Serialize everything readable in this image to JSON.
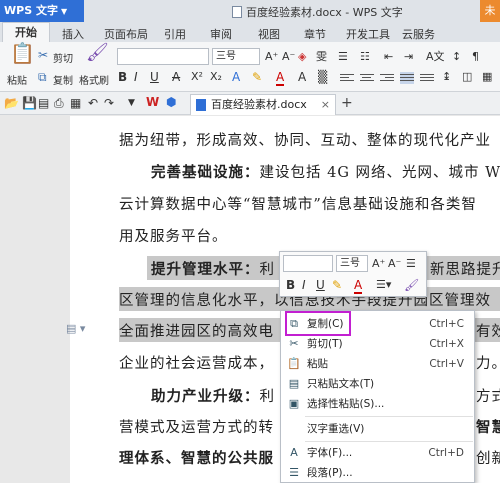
{
  "titlebar": {
    "app": "WPS 文字",
    "doc_title": "百度经验素材.docx - WPS 文字",
    "corner": "未"
  },
  "tabs": [
    "开始",
    "插入",
    "页面布局",
    "引用",
    "审阅",
    "视图",
    "章节",
    "开发工具",
    "云服务"
  ],
  "ribbon": {
    "paste": "粘贴",
    "cut": "剪切",
    "copy": "复制",
    "format_painter": "格式刷",
    "font_size": "三号",
    "font_name": ""
  },
  "doc_tab": {
    "name": "百度经验素材.docx"
  },
  "document": {
    "lines": [
      {
        "text": "据为纽带，形成高效、协同、互动、整体的现代化产业"
      },
      {
        "bold": "完善基础设施：",
        "text": "建设包括 4G 网络、光网、城市 W"
      },
      {
        "text": "云计算数据中心等“智慧城市”信息基础设施和各类智"
      },
      {
        "text": "用及服务平台。"
      },
      {
        "bold": "提升管理水平：",
        "text": "利",
        "tail": "新思路提升"
      },
      {
        "text": "区管理的信息化水平，以信息技术手段提升园区管理效"
      },
      {
        "text": "全面推进园区的高效电",
        "tail": "有效"
      },
      {
        "text": "企业的社会运营成本，",
        "tail": "力。"
      },
      {
        "bold": "助力产业升级：",
        "text": "利",
        "tail": "方式"
      },
      {
        "text": "营模式及运营方式的转",
        "tail": "智慧"
      },
      {
        "bold": "理体系、智慧的公共服",
        "tail": "创新"
      }
    ]
  },
  "mini_toolbar": {
    "font_size": "三号"
  },
  "context_menu": {
    "items": [
      {
        "label": "复制(C)",
        "shortcut": "Ctrl+C",
        "icon": "copy-icon"
      },
      {
        "label": "剪切(T)",
        "shortcut": "Ctrl+X",
        "icon": "scissors-icon"
      },
      {
        "label": "粘贴",
        "shortcut": "Ctrl+V",
        "icon": "paste-icon"
      },
      {
        "label": "只粘贴文本(T)",
        "shortcut": "",
        "icon": "paste-text-icon"
      },
      {
        "label": "选择性粘贴(S)...",
        "shortcut": "",
        "icon": "paste-special-icon"
      },
      {
        "label": "汉字重选(V)",
        "shortcut": "",
        "icon": ""
      },
      {
        "label": "字体(F)...",
        "shortcut": "Ctrl+D",
        "icon": "font-icon"
      },
      {
        "label": "段落(P)...",
        "shortcut": "",
        "icon": "paragraph-icon"
      }
    ]
  },
  "colors": {
    "accent": "#2f6fd6",
    "highlight_box": "#c21fd1",
    "selection": "#c8c8c8"
  }
}
